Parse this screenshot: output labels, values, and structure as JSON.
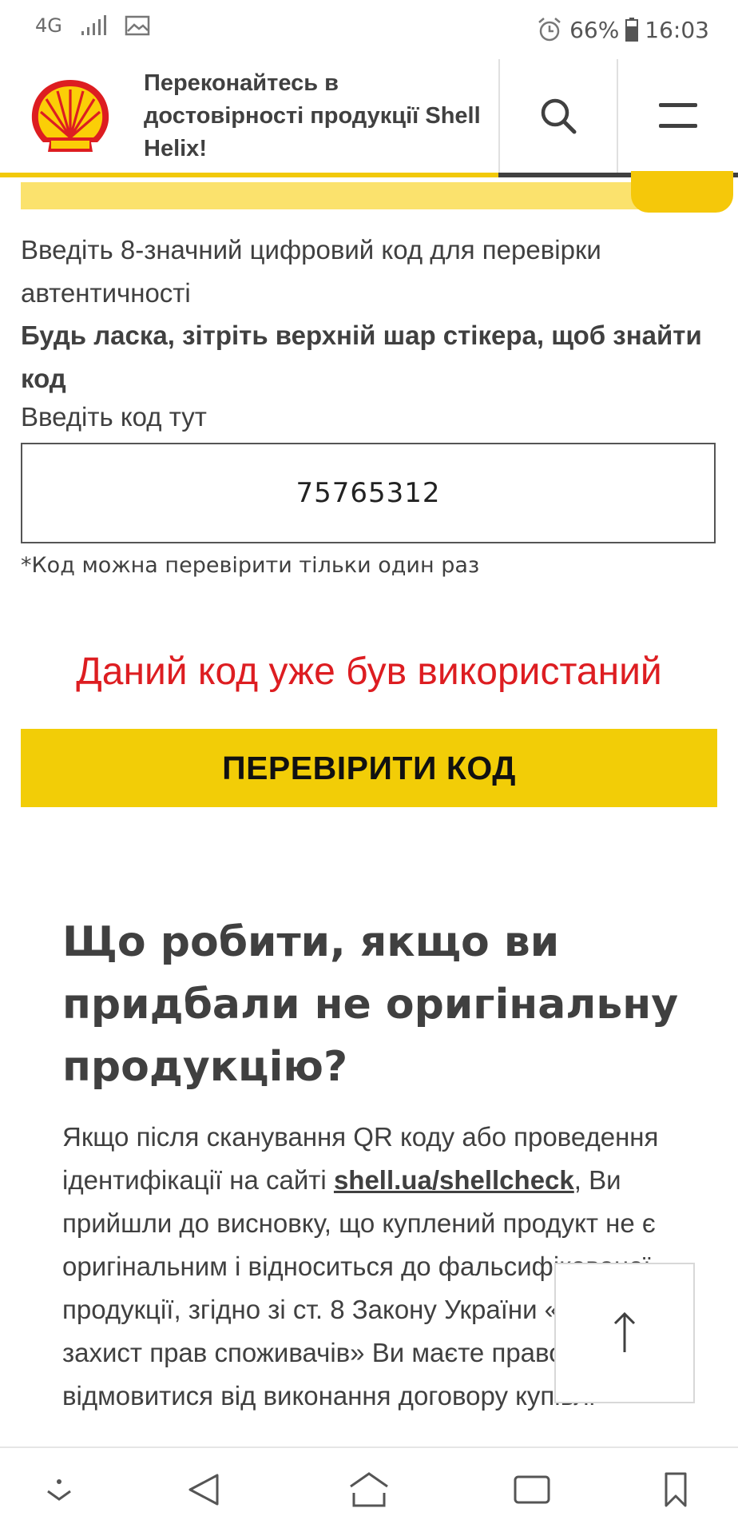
{
  "status_bar": {
    "network": "4G",
    "battery": "66%",
    "time": "16:03"
  },
  "header": {
    "title": "Переконайтесь в достовірності продукції Shell Helix!",
    "brand_colors": {
      "red": "#dd1d21",
      "yellow": "#fbce07"
    }
  },
  "form": {
    "instruction": "Введіть 8-значний цифровий код для перевірки автентичності",
    "instruction_bold": "Будь ласка, зітріть верхній шар стікера, щоб знайти код",
    "code_label": "Введіть код тут",
    "code_value": "75765312",
    "note": "*Код можна перевірити тільки один раз",
    "error_message": "Даний код уже був використаний",
    "check_button_label": "ПЕРЕВІРИТИ КОД",
    "error_color": "#dd1d21",
    "button_color": "#f2cd07"
  },
  "article": {
    "heading": "Що робити, якщо ви придбали не оригінальну продукцію?",
    "para_before_link": "Якщо після сканування QR коду або проведення ідентифікації на сайті ",
    "link_text": "shell.ua/shellcheck",
    "para_after_link": ", Ви прийшли до висновку, що куплений продукт не є оригінальним і відноситься до фальсифікованої продукції, згідно зі ст. 8 Закону України «Про захист прав споживачів» Ви маєте право відмовитися від виконання договору купівлі-"
  },
  "icons": {
    "search": "search-icon",
    "menu": "hamburger-menu-icon",
    "scroll_top": "arrow-up-icon"
  }
}
